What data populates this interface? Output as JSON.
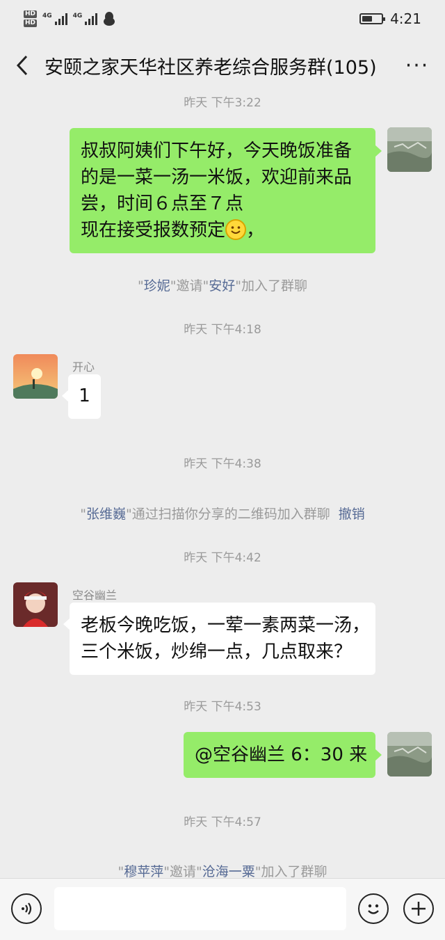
{
  "status_bar": {
    "hd1": "HD",
    "hd2": "HD",
    "network1": "4G",
    "network2": "4G",
    "time": "4:21"
  },
  "header": {
    "title": "安颐之家天华社区养老综合服务群(105)",
    "back_icon": "chevron-left-icon",
    "more_icon": "more-dots-icon",
    "more_label": "···"
  },
  "messages": {
    "ts1": "昨天 下午3:22",
    "msg1": {
      "line1": "叔叔阿姨们下午好，今天晚饭准备",
      "line2": "的是一菜一汤一米饭，欢迎前来品",
      "line3": "尝，时间６点至７点",
      "line4a": "现在接受报数预定",
      "line4b": "，"
    },
    "sys1": {
      "q1": "\"",
      "inviter": "珍妮",
      "mid": "\"邀请\"",
      "invitee": "安好",
      "end": "\"加入了群聊"
    },
    "ts2": "昨天 下午4:18",
    "msg2": {
      "sender": "开心",
      "text": "1"
    },
    "ts3": "昨天 下午4:38",
    "sys2": {
      "q1": "\"",
      "name": "张维巍",
      "mid": "\"通过扫描你分享的二维码加入群聊",
      "action": "撤销"
    },
    "ts4": "昨天 下午4:42",
    "msg3": {
      "sender": "空谷幽兰",
      "line1": "老板今晚吃饭，一荤一素两菜一汤，",
      "line2": "三个米饭，炒绵一点，几点取来？"
    },
    "ts5": "昨天 下午4:53",
    "msg4": {
      "text": "@空谷幽兰  6：30 来"
    },
    "ts6": "昨天 下午4:57",
    "sys3": {
      "q1": "\"",
      "inviter": "穆苹萍",
      "mid": "\"邀请\"",
      "invitee": "沧海一粟",
      "end": "\"加入了群聊"
    }
  },
  "input_bar": {
    "voice_icon": "voice-icon",
    "emoji_icon": "emoji-icon",
    "plus_icon": "plus-icon",
    "text_value": ""
  },
  "colors": {
    "background": "#ededed",
    "bubble_self": "#95ec69",
    "bubble_other": "#ffffff",
    "link_name": "#576b95",
    "timestamp": "#9a9a9a"
  }
}
